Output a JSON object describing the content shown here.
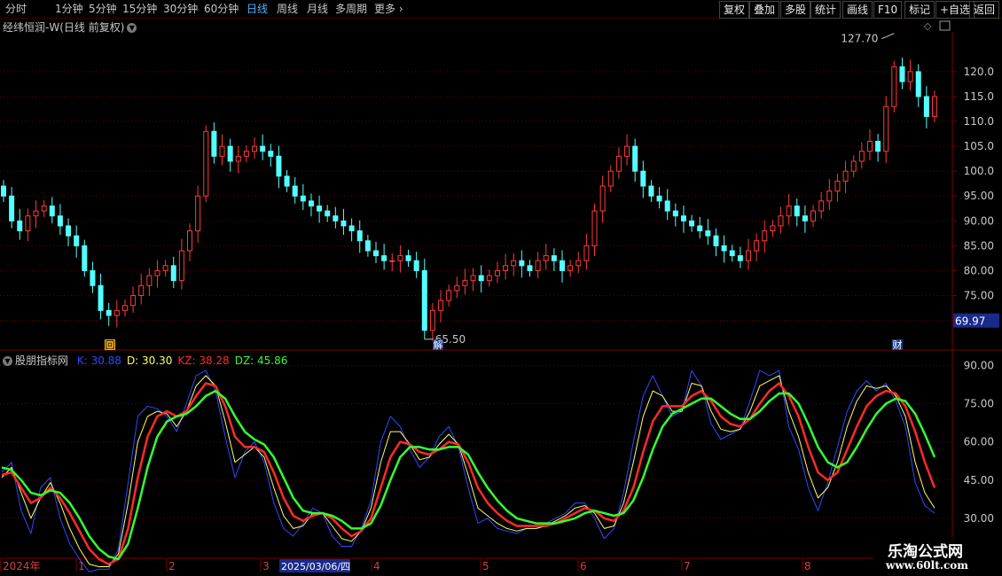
{
  "toolbar": {
    "periods": [
      "分时",
      "1分钟",
      "5分钟",
      "15分钟",
      "30分钟",
      "60分钟",
      "日线",
      "周线",
      "月线",
      "多周期",
      "更多"
    ],
    "active": "日线",
    "right_buttons": [
      "复权",
      "叠加",
      "多股",
      "统计",
      "画线",
      "F10",
      "标记",
      "+自选",
      "返回"
    ]
  },
  "header": {
    "title": "经纬恒润-W(日线 前复权)"
  },
  "indicator": {
    "name": "股朋指标网",
    "values": [
      {
        "label": "K:",
        "value": "30.88",
        "color": "#2b4bff"
      },
      {
        "label": "D:",
        "value": "30.30",
        "color": "#ffff66"
      },
      {
        "label": "KZ:",
        "value": "38.28",
        "color": "#ff2a2a"
      },
      {
        "label": "DZ:",
        "value": "45.86",
        "color": "#33ff33"
      }
    ]
  },
  "price_axis": {
    "ticks": [
      "120.0",
      "115.0",
      "110.0",
      "105.0",
      "100.0",
      "95.00",
      "90.00",
      "85.00",
      "80.00",
      "75.00",
      "70.00"
    ],
    "current": "69.97"
  },
  "ind_axis": {
    "ticks": [
      "90.00",
      "75.00",
      "60.00",
      "45.00",
      "30.00"
    ]
  },
  "annotations": {
    "high": "127.70",
    "low": "65.50",
    "marks": [
      "回",
      "解",
      "财"
    ]
  },
  "date_axis": {
    "labels": [
      "2024年",
      "1",
      "2",
      "3",
      "2025/03/06/四",
      "4",
      "5",
      "6",
      "7",
      "8"
    ]
  },
  "watermark": {
    "line1": "乐淘公式网",
    "line2": "www.60lt.com"
  },
  "colors": {
    "up": "#ff3a3a",
    "down": "#54ffff",
    "grid": "#6a0000",
    "axis": "#c8c8c8"
  },
  "chart_data": {
    "type": "candlestick",
    "title": "经纬恒润-W(日线 前复权)",
    "close": [
      95,
      90,
      88,
      91,
      92,
      93,
      91,
      89,
      87,
      85,
      80,
      77,
      72,
      71,
      72,
      73,
      75,
      77,
      79,
      80,
      81,
      78,
      84,
      88,
      95,
      108,
      103,
      105,
      102,
      103,
      104,
      105,
      104,
      103,
      99,
      97,
      95,
      94,
      93,
      92,
      91,
      90,
      89,
      88,
      86,
      84,
      83,
      82,
      82,
      83,
      82,
      80,
      68,
      72,
      74,
      76,
      77,
      78,
      79,
      78,
      79,
      80,
      81,
      82,
      81,
      80,
      82,
      83,
      82,
      80,
      81,
      82,
      85,
      92,
      97,
      100,
      103,
      105,
      100,
      97,
      95,
      94,
      92,
      91,
      90,
      89,
      88,
      87,
      85,
      84,
      83,
      82,
      84,
      86,
      88,
      89,
      91,
      93,
      91,
      90,
      92,
      94,
      96,
      98,
      100,
      102,
      104,
      106,
      104,
      113,
      121,
      118,
      120,
      115,
      111,
      115
    ],
    "indicator": {
      "series": [
        {
          "name": "K",
          "color": "#2b4bff",
          "values": [
            48,
            52,
            33,
            24,
            42,
            46,
            30,
            20,
            14,
            9,
            10,
            10,
            18,
            44,
            70,
            74,
            73,
            70,
            64,
            75,
            86,
            88,
            80,
            62,
            46,
            56,
            60,
            52,
            36,
            26,
            23,
            28,
            34,
            32,
            23,
            19,
            19,
            26,
            37,
            60,
            70,
            66,
            57,
            50,
            54,
            62,
            66,
            58,
            42,
            28,
            30,
            26,
            25,
            24,
            26,
            26,
            28,
            30,
            32,
            36,
            36,
            30,
            22,
            26,
            40,
            60,
            78,
            86,
            78,
            70,
            72,
            88,
            82,
            67,
            61,
            63,
            65,
            76,
            88,
            86,
            88,
            66,
            57,
            42,
            33,
            44,
            58,
            72,
            80,
            84,
            80,
            83,
            76,
            66,
            44,
            35,
            32
          ]
        },
        {
          "name": "D",
          "color": "#ffff66",
          "values": [
            46,
            50,
            40,
            30,
            38,
            44,
            36,
            26,
            18,
            12,
            11,
            11,
            16,
            36,
            60,
            70,
            72,
            71,
            66,
            72,
            82,
            86,
            82,
            68,
            52,
            55,
            58,
            54,
            42,
            31,
            26,
            27,
            32,
            32,
            27,
            22,
            21,
            25,
            34,
            52,
            64,
            64,
            59,
            53,
            54,
            59,
            63,
            59,
            47,
            34,
            31,
            28,
            26,
            25,
            26,
            26,
            27,
            29,
            31,
            34,
            35,
            32,
            26,
            27,
            36,
            52,
            70,
            80,
            78,
            72,
            72,
            83,
            82,
            72,
            65,
            64,
            65,
            72,
            82,
            84,
            86,
            72,
            62,
            48,
            38,
            42,
            52,
            66,
            76,
            82,
            81,
            82,
            78,
            70,
            52,
            40,
            34
          ]
        },
        {
          "name": "KZ",
          "color": "#ff2a2a",
          "values": [
            47,
            48,
            42,
            36,
            38,
            42,
            38,
            32,
            25,
            18,
            14,
            12,
            14,
            26,
            46,
            62,
            70,
            72,
            70,
            72,
            78,
            83,
            82,
            74,
            62,
            58,
            58,
            56,
            48,
            38,
            31,
            29,
            31,
            32,
            30,
            26,
            23,
            25,
            30,
            42,
            54,
            60,
            59,
            56,
            55,
            57,
            60,
            59,
            52,
            42,
            36,
            32,
            29,
            27,
            27,
            27,
            27,
            28,
            30,
            32,
            34,
            33,
            30,
            29,
            33,
            42,
            56,
            68,
            74,
            74,
            74,
            78,
            80,
            76,
            70,
            67,
            66,
            69,
            75,
            80,
            83,
            78,
            70,
            58,
            48,
            45,
            48,
            57,
            66,
            74,
            78,
            80,
            79,
            74,
            64,
            52,
            42
          ]
        },
        {
          "name": "DZ",
          "color": "#33ff33",
          "values": [
            50,
            49,
            45,
            40,
            39,
            41,
            40,
            36,
            30,
            23,
            18,
            15,
            14,
            20,
            34,
            50,
            62,
            68,
            70,
            71,
            74,
            78,
            80,
            77,
            70,
            64,
            61,
            59,
            54,
            46,
            38,
            33,
            32,
            32,
            31,
            29,
            26,
            26,
            28,
            35,
            45,
            54,
            58,
            58,
            57,
            57,
            58,
            58,
            55,
            48,
            42,
            37,
            33,
            30,
            29,
            28,
            28,
            28,
            29,
            30,
            32,
            33,
            32,
            31,
            32,
            37,
            46,
            57,
            66,
            71,
            73,
            75,
            77,
            77,
            74,
            71,
            69,
            69,
            72,
            76,
            79,
            79,
            75,
            67,
            58,
            52,
            50,
            52,
            58,
            65,
            71,
            75,
            77,
            76,
            71,
            63,
            54
          ]
        }
      ],
      "ylim": [
        15,
        95
      ]
    },
    "ylim": [
      66,
      128
    ]
  }
}
